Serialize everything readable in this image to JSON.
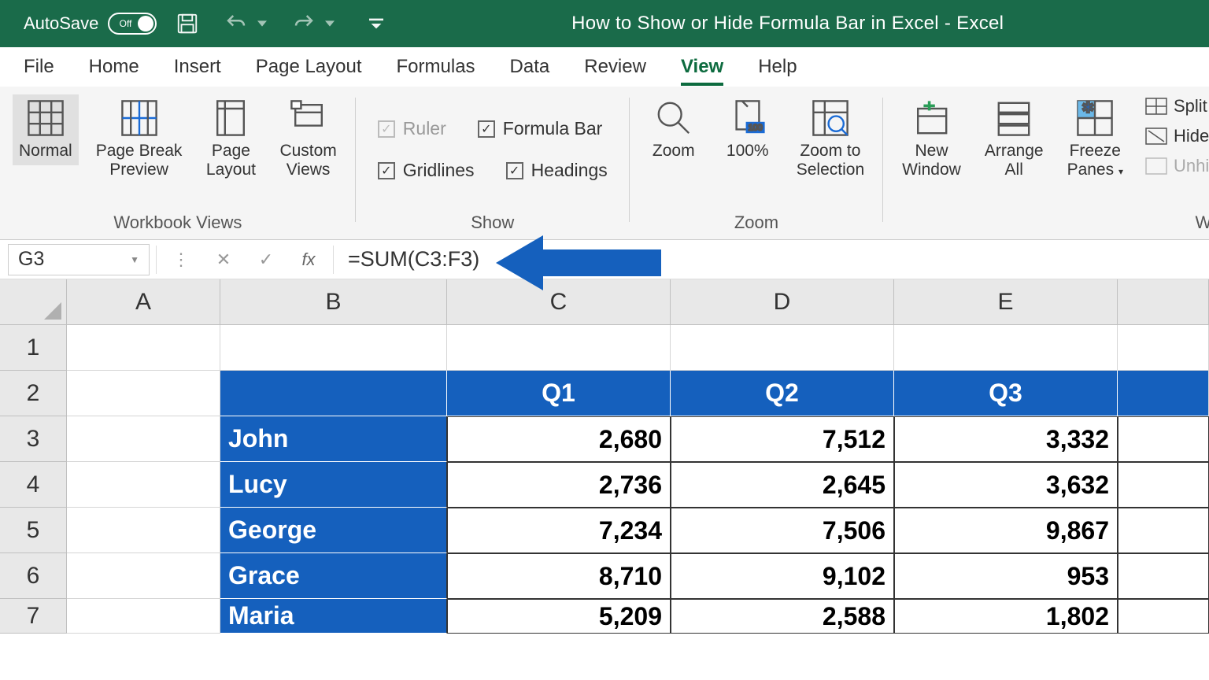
{
  "titlebar": {
    "autosave_label": "AutoSave",
    "autosave_state": "Off",
    "document_title": "How to Show or Hide Formula Bar in Excel  -  Excel"
  },
  "tabs": {
    "file": "File",
    "home": "Home",
    "insert": "Insert",
    "page_layout": "Page Layout",
    "formulas": "Formulas",
    "data": "Data",
    "review": "Review",
    "view": "View",
    "help": "Help"
  },
  "ribbon": {
    "workbook_views": {
      "label": "Workbook Views",
      "normal": "Normal",
      "page_break": "Page Break\nPreview",
      "page_layout": "Page\nLayout",
      "custom_views": "Custom\nViews"
    },
    "show": {
      "label": "Show",
      "ruler": "Ruler",
      "formula_bar": "Formula Bar",
      "gridlines": "Gridlines",
      "headings": "Headings"
    },
    "zoom": {
      "label": "Zoom",
      "zoom": "Zoom",
      "hundred": "100%",
      "zoom_selection": "Zoom to\nSelection"
    },
    "window": {
      "label": "Window",
      "new_window": "New\nWindow",
      "arrange_all": "Arrange\nAll",
      "freeze_panes": "Freeze\nPanes",
      "split": "Split",
      "hide": "Hide",
      "unhide": "Unhide"
    }
  },
  "formula_bar": {
    "name_box": "G3",
    "fx_label": "fx",
    "formula": "=SUM(C3:F3)"
  },
  "columns": [
    "A",
    "B",
    "C",
    "D",
    "E"
  ],
  "sheet": {
    "headers": {
      "b": "",
      "c": "Q1",
      "d": "Q2",
      "e": "Q3"
    },
    "rows": [
      {
        "num": "1"
      },
      {
        "num": "2"
      },
      {
        "num": "3",
        "name": "John",
        "q1": "2,680",
        "q2": "7,512",
        "q3": "3,332"
      },
      {
        "num": "4",
        "name": "Lucy",
        "q1": "2,736",
        "q2": "2,645",
        "q3": "3,632"
      },
      {
        "num": "5",
        "name": "George",
        "q1": "7,234",
        "q2": "7,506",
        "q3": "9,867"
      },
      {
        "num": "6",
        "name": "Grace",
        "q1": "8,710",
        "q2": "9,102",
        "q3": "953"
      },
      {
        "num": "7",
        "name": "Maria",
        "q1": "5,209",
        "q2": "2,588",
        "q3": "1,802"
      }
    ]
  }
}
